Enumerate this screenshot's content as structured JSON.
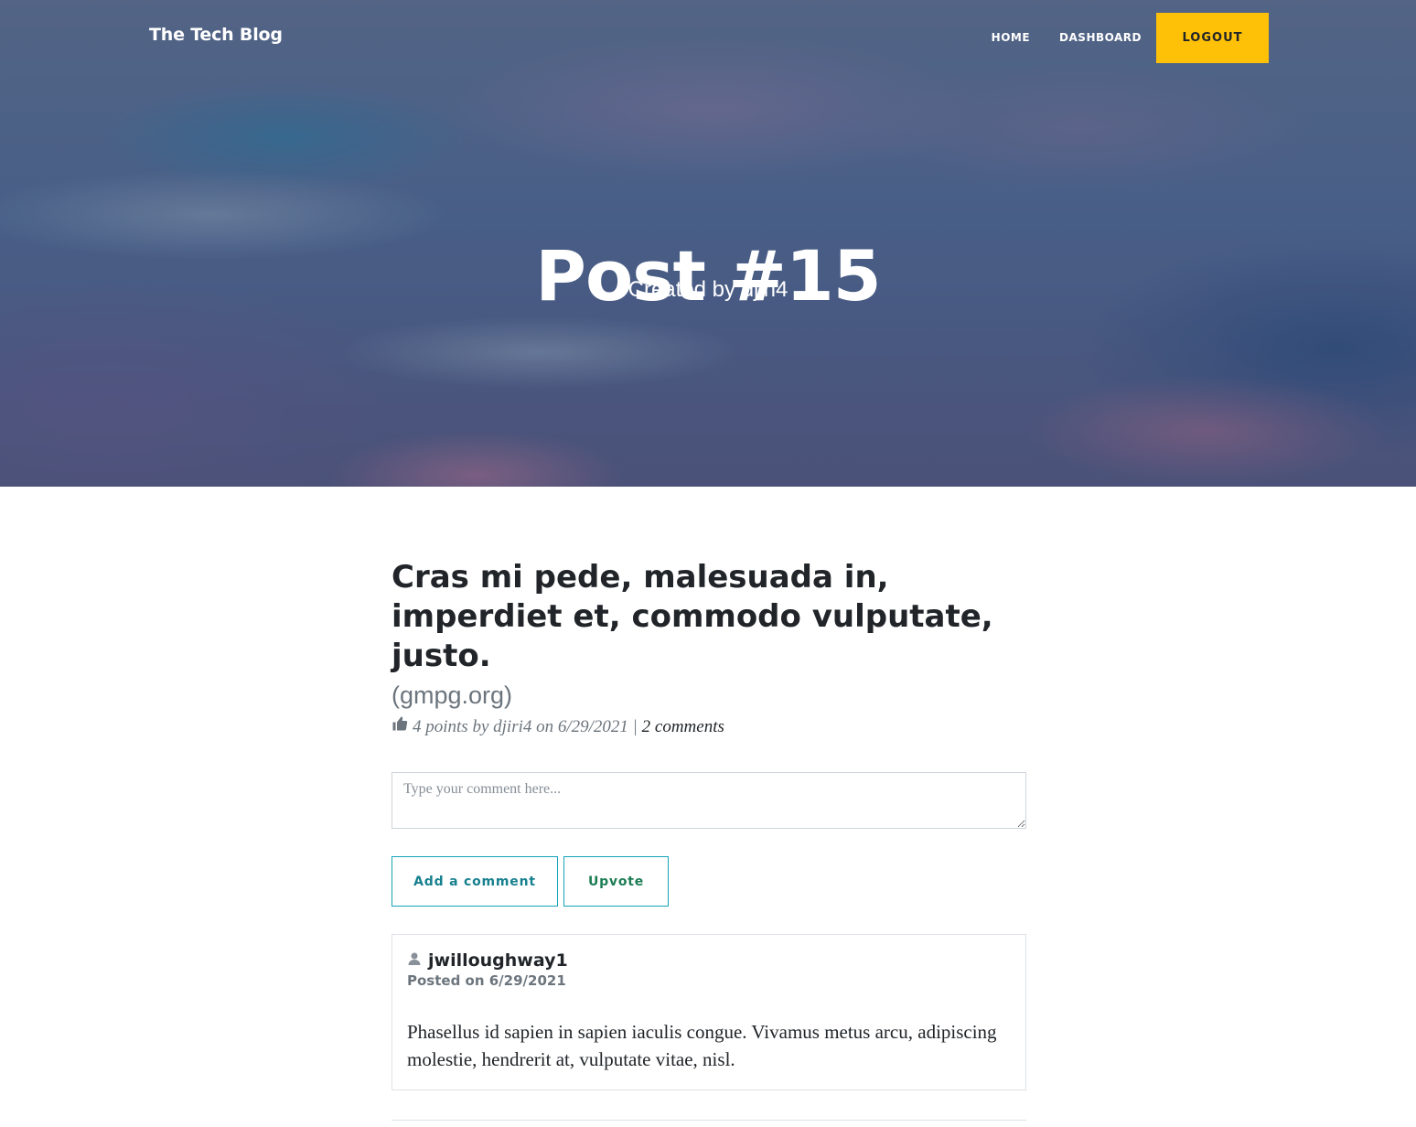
{
  "header": {
    "brand": "The Tech Blog",
    "nav": {
      "home": "HOME",
      "dashboard": "DASHBOARD",
      "logout": "LOGOUT"
    },
    "title": "Post #15",
    "subtitle": "Created by djiri4"
  },
  "post": {
    "title": "Cras mi pede, malesuada in, imperdiet et, commodo vulputate, justo.",
    "domain": "(gmpg.org)",
    "meta_prefix": "4 points by djiri4 on 6/29/2021 |",
    "comments_link": "2 comments",
    "icons": [
      "thumbs-up-icon"
    ]
  },
  "comment_form": {
    "placeholder": "Type your comment here...",
    "add_comment_label": "Add a comment",
    "upvote_label": "Upvote"
  },
  "comments": [
    {
      "author": "jwilloughway1",
      "date": "Posted on 6/29/2021",
      "body": "Phasellus id sapien in sapien iaculis congue. Vivamus metus arcu, adipiscing molestie, hendrerit at, vulputate vitae, nisl.",
      "icon": "user-icon"
    }
  ],
  "colors": {
    "accent": "#ffc107",
    "button_border": "#17a2b8",
    "upvote_text": "#1c7c54",
    "muted": "#6c757d"
  }
}
